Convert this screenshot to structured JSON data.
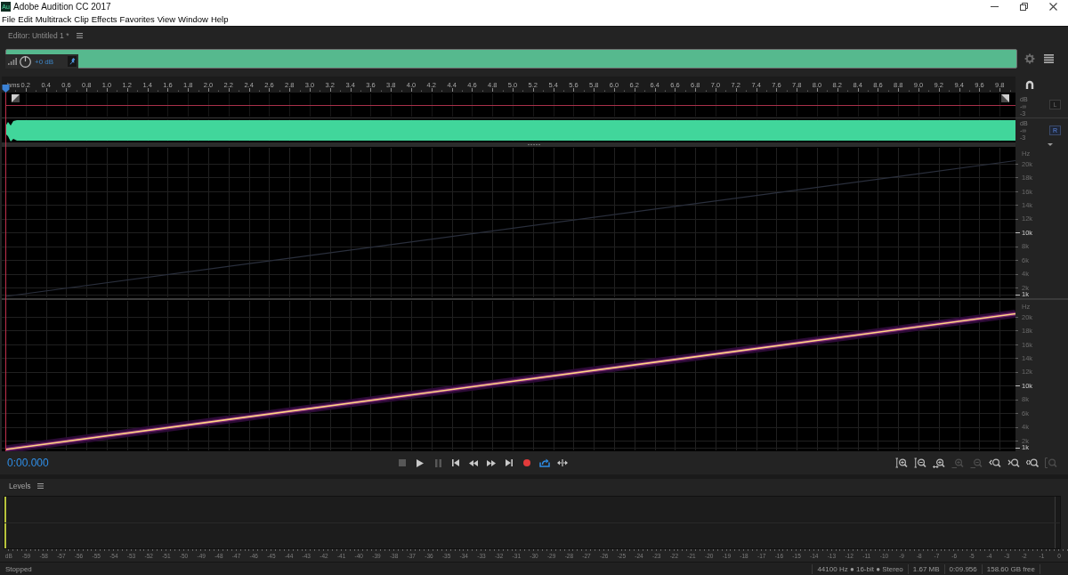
{
  "window": {
    "icon_text": "Au",
    "title": "Adobe Audition CC 2017"
  },
  "menu": [
    "File",
    "Edit",
    "Multitrack",
    "Clip",
    "Effects",
    "Favorites",
    "View",
    "Window",
    "Help"
  ],
  "editor": {
    "title": "Editor: Untitled 1 *",
    "volume": "+0 dB",
    "ruler": {
      "unit": "hms",
      "labels": [
        "0.2",
        "0.4",
        "0.6",
        "0.8",
        "1.0",
        "1.2",
        "1.4",
        "1.6",
        "1.8",
        "2.0",
        "2.2",
        "2.4",
        "2.6",
        "2.8",
        "3.0",
        "3.2",
        "3.4",
        "3.6",
        "3.8",
        "4.0",
        "4.2",
        "4.4",
        "4.6",
        "4.8",
        "5.0",
        "5.2",
        "5.4",
        "5.6",
        "5.8",
        "6.0",
        "6.2",
        "6.4",
        "6.6",
        "6.8",
        "7.0",
        "7.2",
        "7.4",
        "7.6",
        "7.8",
        "8.0",
        "8.2",
        "8.4",
        "8.6",
        "8.8",
        "9.0",
        "9.2",
        "9.4",
        "9.6",
        "9.8"
      ]
    },
    "channels": [
      {
        "label": "L",
        "selected": false,
        "db_labels": [
          "dB",
          "-∞",
          "-3"
        ],
        "hz_unit": "Hz",
        "hz_labels": [
          {
            "text": "20k",
            "major": false
          },
          {
            "text": "18k",
            "major": false
          },
          {
            "text": "16k",
            "major": false
          },
          {
            "text": "14k",
            "major": false
          },
          {
            "text": "12k",
            "major": false
          },
          {
            "text": "10k",
            "major": true
          },
          {
            "text": "8k",
            "major": false
          },
          {
            "text": "6k",
            "major": false
          },
          {
            "text": "4k",
            "major": false
          },
          {
            "text": "2k",
            "major": false
          },
          {
            "text": "1k",
            "major": true
          }
        ]
      },
      {
        "label": "R",
        "selected": true,
        "db_labels": [
          "dB",
          "-∞",
          "-3"
        ],
        "hz_unit": "Hz",
        "hz_labels": [
          {
            "text": "20k",
            "major": false
          },
          {
            "text": "18k",
            "major": false
          },
          {
            "text": "16k",
            "major": false
          },
          {
            "text": "14k",
            "major": false
          },
          {
            "text": "12k",
            "major": false
          },
          {
            "text": "10k",
            "major": true
          },
          {
            "text": "8k",
            "major": false
          },
          {
            "text": "6k",
            "major": false
          },
          {
            "text": "4k",
            "major": false
          },
          {
            "text": "2k",
            "major": false
          },
          {
            "text": "1k",
            "major": true
          }
        ]
      }
    ]
  },
  "transport": {
    "time": "0:00.000",
    "buttons": [
      {
        "kind": "stop",
        "disabled": true,
        "on": false
      },
      {
        "kind": "play",
        "disabled": false,
        "on": false
      },
      {
        "kind": "pause",
        "disabled": true,
        "on": false
      },
      {
        "kind": "start",
        "disabled": false,
        "on": false
      },
      {
        "kind": "rewind",
        "disabled": false,
        "on": false
      },
      {
        "kind": "forward",
        "disabled": false,
        "on": false
      },
      {
        "kind": "end",
        "disabled": false,
        "on": false
      },
      {
        "kind": "record",
        "disabled": false,
        "on": false
      },
      {
        "kind": "loop",
        "disabled": false,
        "on": true
      },
      {
        "kind": "skip",
        "disabled": false,
        "on": false
      }
    ],
    "zoom_buttons": [
      {
        "kind": "ampin",
        "disabled": false
      },
      {
        "kind": "ampout",
        "disabled": false
      },
      {
        "kind": "full",
        "disabled": false
      },
      {
        "kind": "timein",
        "disabled": true
      },
      {
        "kind": "timeout",
        "disabled": true
      },
      {
        "kind": "inpoint",
        "disabled": false
      },
      {
        "kind": "outpoint",
        "disabled": false
      },
      {
        "kind": "both",
        "disabled": false
      },
      {
        "kind": "selection",
        "disabled": true
      }
    ]
  },
  "levels": {
    "title": "Levels",
    "meters": [
      {
        "level": 0
      },
      {
        "level": 0
      }
    ],
    "scale": [
      "dB",
      "-59",
      "-58",
      "-57",
      "-56",
      "-55",
      "-54",
      "-53",
      "-52",
      "-51",
      "-50",
      "-49",
      "-48",
      "-47",
      "-46",
      "-45",
      "-44",
      "-43",
      "-42",
      "-41",
      "-40",
      "-39",
      "-38",
      "-37",
      "-36",
      "-35",
      "-34",
      "-33",
      "-32",
      "-31",
      "-30",
      "-29",
      "-28",
      "-27",
      "-26",
      "-25",
      "-24",
      "-23",
      "-22",
      "-21",
      "-20",
      "-19",
      "-18",
      "-17",
      "-16",
      "-15",
      "-14",
      "-13",
      "-12",
      "-11",
      "-10",
      "-9",
      "-8",
      "-7",
      "-6",
      "-5",
      "-4",
      "-3",
      "-2",
      "-1",
      "0"
    ]
  },
  "status_bar": {
    "state": "Stopped",
    "items": [
      "44100 Hz ● 16-bit ● Stereo",
      "1.67 MB",
      "0:09.956",
      "158.60 GB free"
    ]
  }
}
